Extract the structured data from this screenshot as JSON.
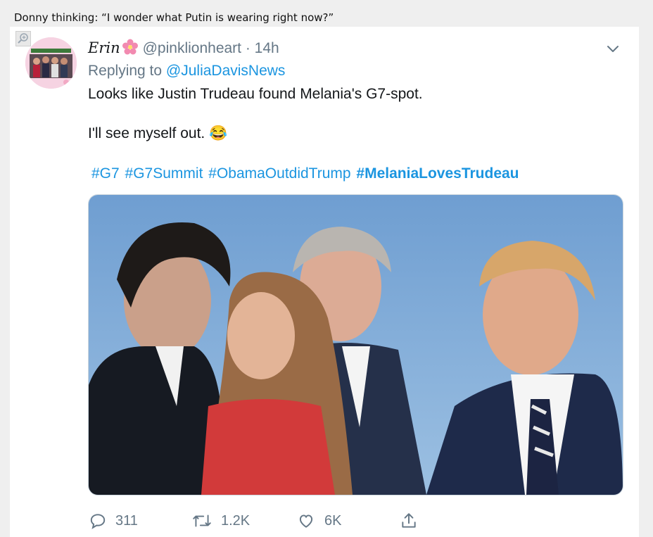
{
  "caption": "Donny thinking: “I wonder what Putin is wearing right now?”",
  "tweet": {
    "display_name": "Erin",
    "handle": "@pinklionheart",
    "time": "· 14h",
    "replying_label": "Replying to",
    "replying_to": "@JuliaDavisNews",
    "line1": "Looks like Justin Trudeau found Melania's G7-spot.",
    "line2": "I'll see myself out.",
    "emoji": "😂",
    "hashtags": [
      "#G7",
      "#G7Summit",
      "#ObamaOutdidTrump",
      "#MelaniaLovesTrudeau"
    ],
    "image_alt": "Photo of world leaders at the G7 summit against a blue evening sky",
    "stats": {
      "replies": "311",
      "retweets": "1.2K",
      "likes": "6K"
    }
  },
  "colors": {
    "link": "#1b95e0",
    "muted": "#657786",
    "text": "#14171a",
    "border": "#ccd6dd"
  },
  "icons": [
    "zoom-icon",
    "flower-icon",
    "chevron-down-icon",
    "reply-icon",
    "retweet-icon",
    "like-icon",
    "share-icon"
  ]
}
